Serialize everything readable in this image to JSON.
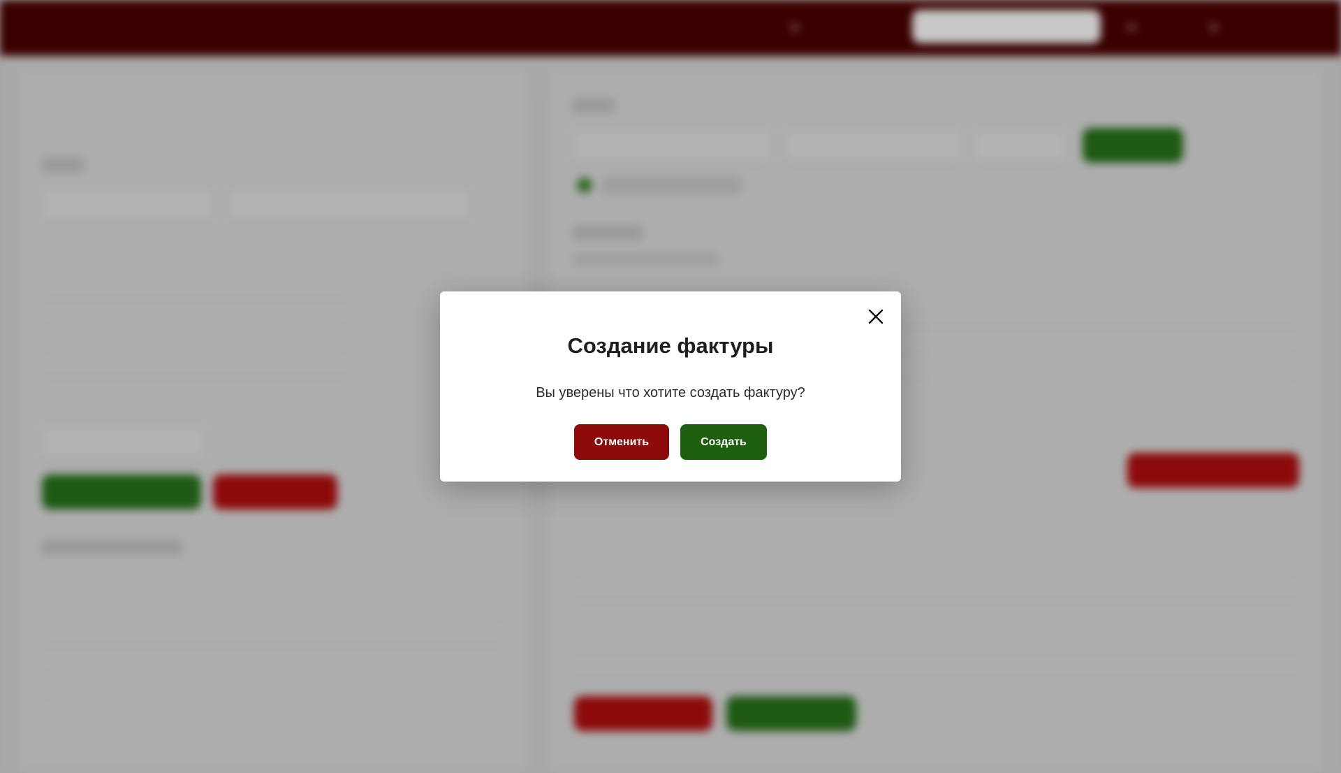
{
  "header": {
    "brand_line1": "",
    "brand_line2": "",
    "nav": [
      "",
      "",
      ""
    ],
    "search_placeholder": ""
  },
  "background": {
    "left_title": "",
    "right_title": ""
  },
  "modal": {
    "title": "Создание фактуры",
    "message": "Вы уверены что хотите создать фактуру?",
    "cancel_label": "Отменить",
    "confirm_label": "Создать",
    "close_icon": "close-icon"
  },
  "colors": {
    "header": "#3a0000",
    "cancel": "#8e0b0b",
    "confirm": "#1e6010",
    "overlay": "#a9a9a9"
  }
}
